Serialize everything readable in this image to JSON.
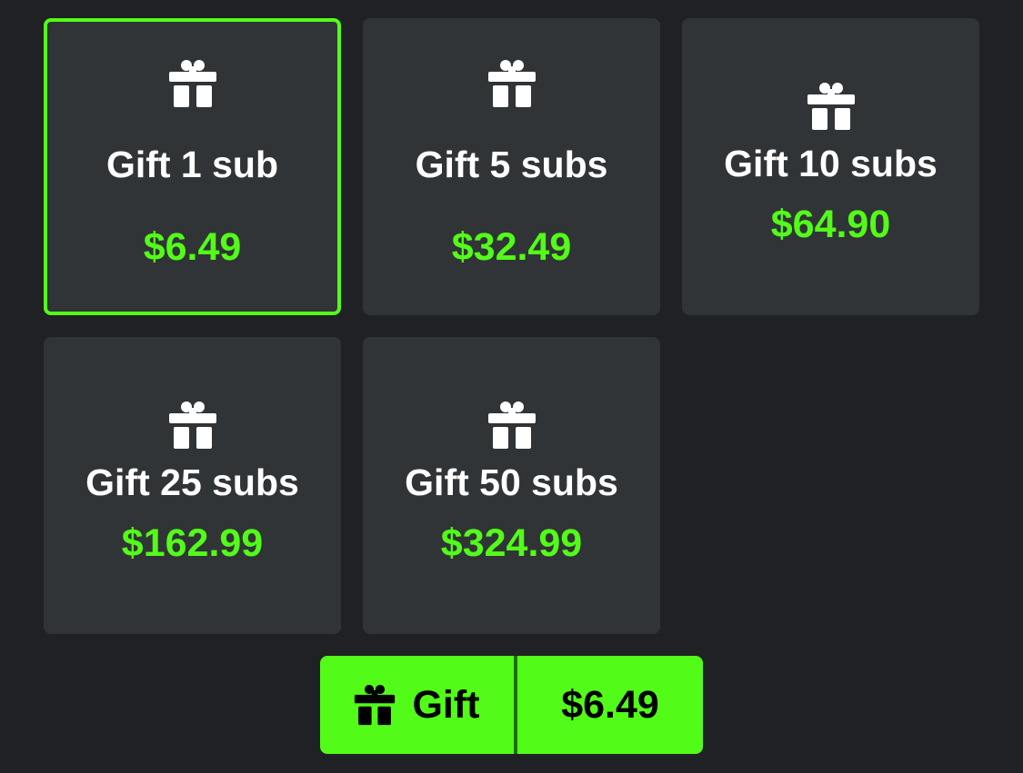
{
  "colors": {
    "background": "#202124",
    "card": "#313437",
    "accent": "#53fc18",
    "label": "#ffffff",
    "button_text": "#000000"
  },
  "options": [
    {
      "label": "Gift 1 sub",
      "price": "$6.49",
      "selected": true,
      "icon": "gift-icon"
    },
    {
      "label": "Gift 5 subs",
      "price": "$32.49",
      "selected": false,
      "icon": "gift-icon"
    },
    {
      "label": "Gift 10 subs",
      "price": "$64.90",
      "selected": false,
      "icon": "gift-icon"
    },
    {
      "label": "Gift 25 subs",
      "price": "$162.99",
      "selected": false,
      "icon": "gift-icon"
    },
    {
      "label": "Gift 50 subs",
      "price": "$324.99",
      "selected": false,
      "icon": "gift-icon"
    }
  ],
  "gift_button": {
    "icon": "gift-icon",
    "label": "Gift",
    "price": "$6.49"
  }
}
